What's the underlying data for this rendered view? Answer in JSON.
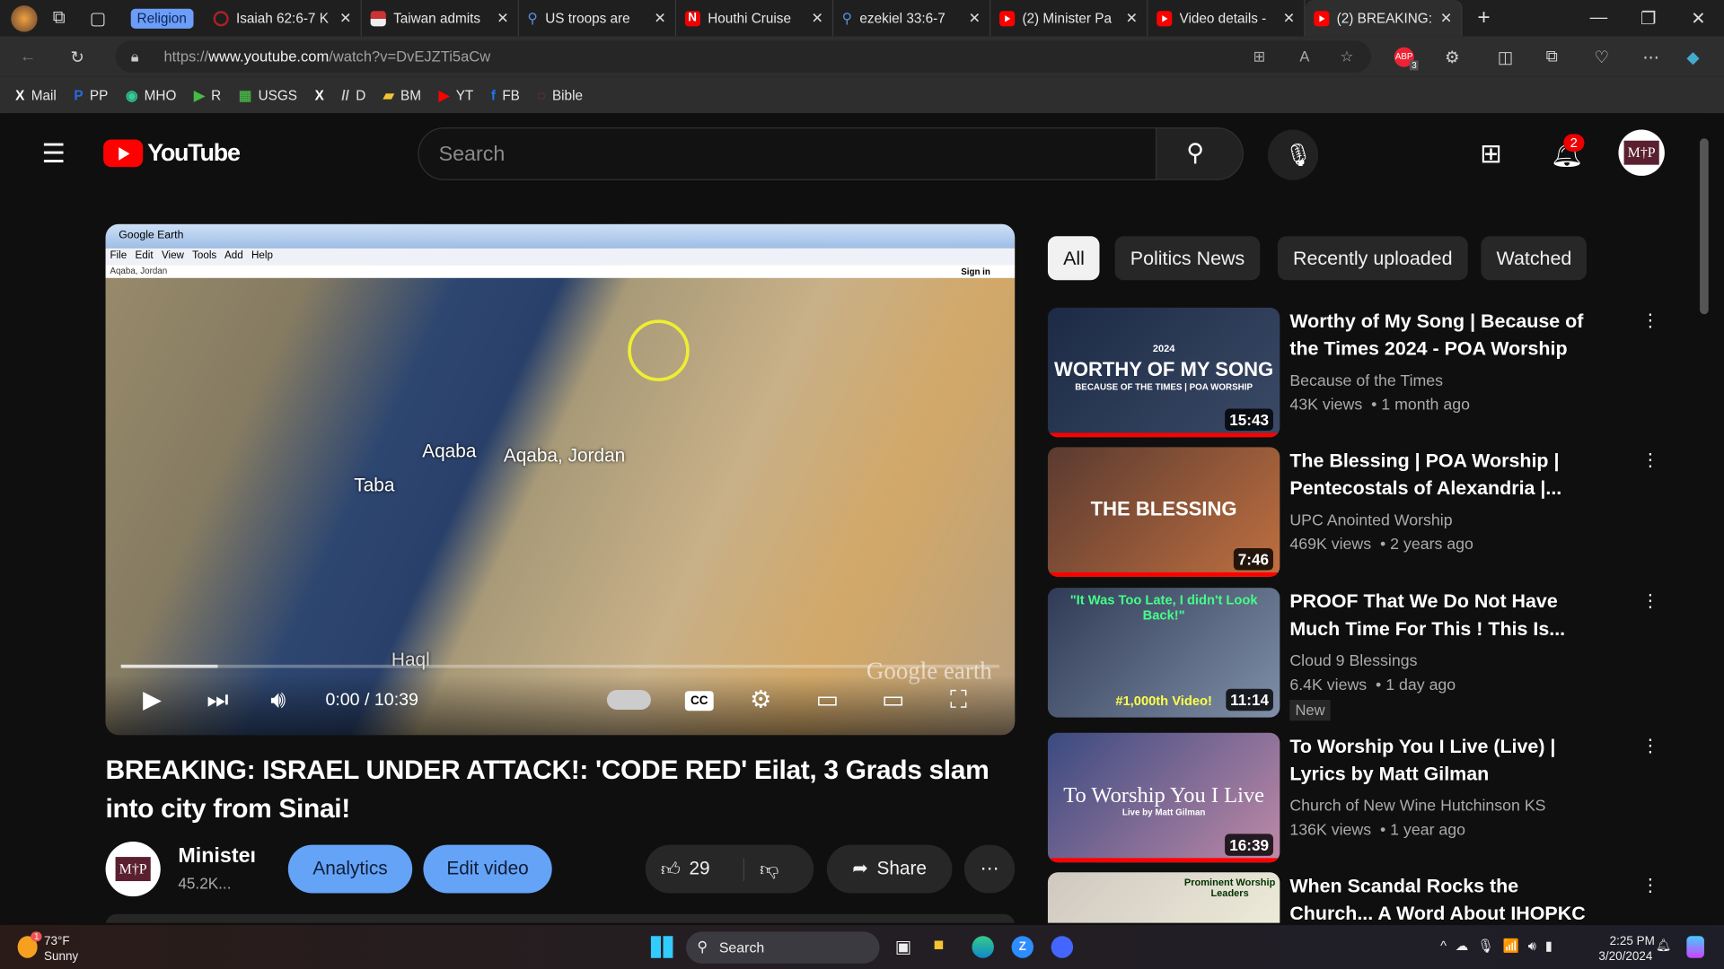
{
  "browser": {
    "group_label": "Religion",
    "tabs": [
      {
        "title": "Isaiah 62:6-7 K",
        "icon": "red-arc-icon"
      },
      {
        "title": "Taiwan admits",
        "icon": "flag-icon"
      },
      {
        "title": "US troops are",
        "icon": "search-icon"
      },
      {
        "title": "Houthi Cruise",
        "icon": "n-logo-icon"
      },
      {
        "title": "ezekiel 33:6-7",
        "icon": "search-icon"
      },
      {
        "title": "(2) Minister Pa",
        "icon": "youtube-icon"
      },
      {
        "title": "Video details -",
        "icon": "youtube-icon"
      },
      {
        "title": "(2) BREAKING:",
        "icon": "youtube-icon",
        "active": true
      }
    ],
    "url_prefix": "https://",
    "url_host": "www.youtube.com",
    "url_path": "/watch?v=DvEJZTi5aCw",
    "extension_badge": "3",
    "bookmarks": [
      "Mail",
      "PP",
      "MHO",
      "R",
      "USGS",
      "",
      "D",
      "BM",
      "YT",
      "FB",
      "Bible"
    ]
  },
  "youtube": {
    "logo_text": "YouTube",
    "search_placeholder": "Search",
    "notification_count": "2",
    "avatar_text": "M†P",
    "video": {
      "title": "BREAKING: ISRAEL UNDER ATTACK!: 'CODE RED' Eilat, 3 Grads slam into city from Sinai!",
      "time": "0:00 / 10:39",
      "progress_fraction": 0.0,
      "buffered_fraction": 0.11,
      "frame": {
        "window_title": "Google Earth",
        "menu": "File Edit View Tools Add Help",
        "search_text": "Aqaba, Jordan",
        "sign_in": "Sign in",
        "labels": [
          "Aqaba",
          "Aqaba, Jordan",
          "Taba",
          "Haql",
          "Google earth"
        ]
      }
    },
    "channel": {
      "name": "Ministeı",
      "subs": "45.2K..."
    },
    "buttons": {
      "analytics": "Analytics",
      "edit": "Edit video",
      "likes": "29",
      "share": "Share"
    },
    "chips": [
      "All",
      "Politics News",
      "Recently uploaded",
      "Watched"
    ],
    "recommendations": [
      {
        "title": "Worthy of My Song | Because of the Times 2024 - POA Worship",
        "channel": "Because of the Times",
        "meta": "43K views  • 1 month ago",
        "duration": "15:43",
        "thumb_text": "WORTHY OF MY SONG",
        "thumb_sub": "BECAUSE OF THE TIMES | POA WORSHIP",
        "thumb_year": "2024",
        "colors": [
          "#1c2a45",
          "#3b4a66"
        ]
      },
      {
        "title": "The Blessing | POA Worship | Pentecostals of Alexandria |...",
        "channel": "UPC Anointed Worship",
        "meta": "469K views  • 2 years ago",
        "duration": "7:46",
        "thumb_text": "THE BLESSING",
        "colors": [
          "#5a3a30",
          "#c07040"
        ]
      },
      {
        "title": "PROOF That We Do Not Have Much Time For This ! This Is...",
        "channel": "Cloud 9 Blessings",
        "meta": "6.4K views  • 1 day ago",
        "badge": "New",
        "duration": "11:14",
        "thumb_text": "\"It Was Too Late, I didn't Look Back!\"",
        "thumb_sub": "#1,000th Video!",
        "colors": [
          "#303a55",
          "#8090a8"
        ]
      },
      {
        "title": "To Worship You I Live (Live) | Lyrics by Matt Gilman",
        "channel": "Church of New Wine Hutchinson KS",
        "meta": "136K views  • 1 year ago",
        "duration": "16:39",
        "thumb_text": "To Worship You I Live",
        "thumb_sub": "Live by Matt Gilman",
        "colors": [
          "#3a4a80",
          "#c08aa8"
        ]
      },
      {
        "title": "When Scandal Rocks the Church... A Word About IHOPKC",
        "channel": "",
        "meta": "",
        "thumb_text": "Prominent Worship Leaders",
        "colors": [
          "#d0c8c0",
          "#f4f4e0"
        ]
      }
    ]
  },
  "taskbar": {
    "weather_temp": "73°F",
    "weather_text": "Sunny",
    "weather_badge": "1",
    "search": "Search",
    "time": "2:25 PM",
    "date": "3/20/2024"
  }
}
